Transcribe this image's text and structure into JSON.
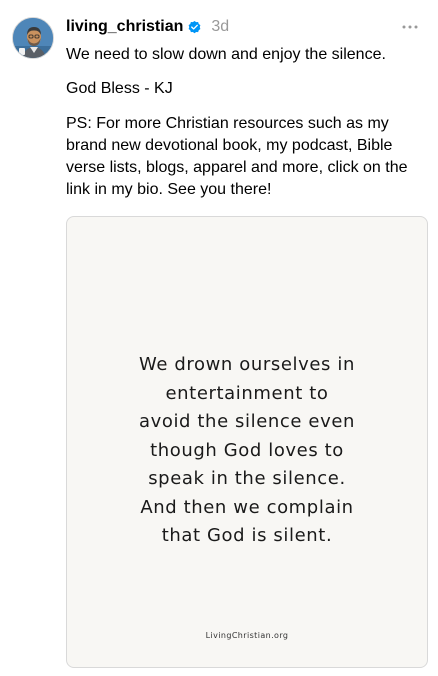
{
  "post": {
    "username": "living_christian",
    "timestamp": "3d",
    "avatar_icon": "profile-avatar",
    "verified_icon": "verified-badge-icon",
    "verified_color": "#0095f6",
    "more_icon": "more-options-icon",
    "paragraphs": [
      "We need to slow down and enjoy the silence.",
      "God Bless - KJ",
      "PS: For more Christian resources such as my brand new devotional book, my podcast, Bible verse lists, blogs, apparel and more, click on the link in my bio. See you there!"
    ],
    "image": {
      "quote_lines": [
        "We drown ourselves in",
        "entertainment to",
        "avoid the silence even",
        "though God loves to",
        "speak in the silence.",
        "And then we complain",
        "that God is silent."
      ],
      "watermark": "LivingChristian.org"
    }
  }
}
